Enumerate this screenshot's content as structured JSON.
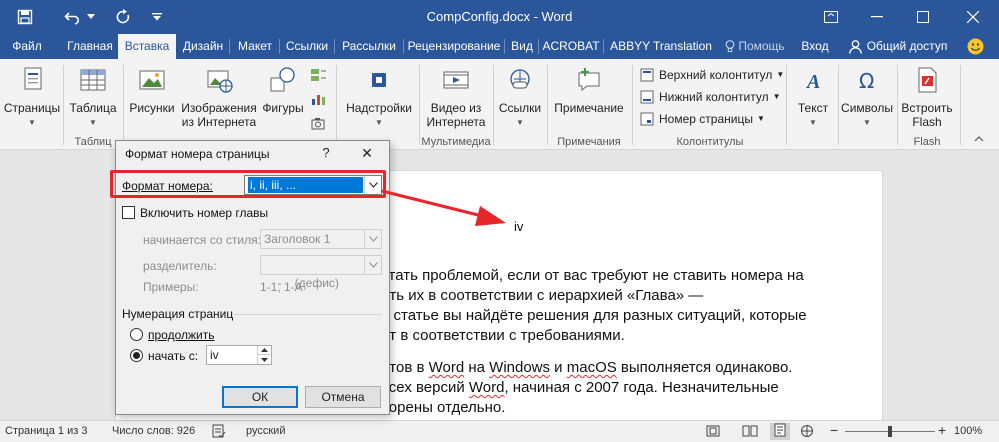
{
  "window": {
    "title": "CompConfig.docx - Word"
  },
  "tabs": [
    {
      "label": "Файл"
    },
    {
      "label": "Главная"
    },
    {
      "label": "Вставка"
    },
    {
      "label": "Дизайн"
    },
    {
      "label": "Макет"
    },
    {
      "label": "Ссылки"
    },
    {
      "label": "Рассылки"
    },
    {
      "label": "Рецензирование"
    },
    {
      "label": "Вид"
    },
    {
      "label": "ACROBAT"
    },
    {
      "label": "ABBYY Translation"
    },
    {
      "label": "Помощь"
    },
    {
      "label": "Вход"
    },
    {
      "label": "Общий доступ"
    }
  ],
  "ribbon": {
    "pages": "Страницы",
    "table": "Таблица",
    "tables_group": "Таблиц",
    "pictures": "Рисунки",
    "online_pictures_1": "Изображения",
    "online_pictures_2": "из Интернета",
    "shapes": "Фигуры",
    "addins": "Надстройки",
    "video_1": "Видео из",
    "video_2": "Интернета",
    "multimedia_group": "Мультимедиа",
    "links": "Ссылки",
    "comment": "Примечание",
    "comments_group": "Примечания",
    "header": "Верхний колонтитул",
    "footer": "Нижний колонтитул",
    "page_number": "Номер страницы",
    "hf_group": "Колонтитулы",
    "text": "Текст",
    "symbols": "Символы",
    "flash_1": "Встроить",
    "flash_2": "Flash",
    "flash_group": "Flash"
  },
  "document": {
    "page_number": "iv",
    "lines": [
      "стать проблемой, если от вас требуют не ставить номера на",
      "ить их в соответствии с иерархией «Глава» —",
      "й статье вы найдёте решения для разных ситуаций, которые",
      "нт в соответствии с требованиями."
    ],
    "para2_pre": "нтов в ",
    "para2_w1": "Word",
    "para2_mid1": " на ",
    "para2_w2": "Windows",
    "para2_mid2": " и ",
    "para2_w3": "macOS",
    "para2_post": " выполняется одинаково.",
    "para3_pre": "всех версий ",
    "para3_w1": "Word",
    "para3_post": ", начиная с 2007 года. Незначительные",
    "para4": "ворены отдельно."
  },
  "dialog": {
    "title": "Формат номера страницы",
    "help": "?",
    "close": "✕",
    "format_label": "Формат номера:",
    "format_value": "i, ii, iii, ...",
    "include_chapter": "Включить номер главы",
    "starts_with_label": "начинается со стиля:",
    "starts_with_value": "Заголовок 1",
    "separator_label": "разделитель:",
    "separator_value": "-    (дефис)",
    "examples_label": "Примеры:",
    "examples_value": "1-1, 1-A",
    "numbering_group": "Нумерация страниц",
    "continue": "продолжить",
    "start_at": "начать с:",
    "start_at_value": "iv",
    "ok": "ОК",
    "cancel": "Отмена"
  },
  "status": {
    "page": "Страница 1 из 3",
    "words": "Число слов: 926",
    "language": "русский",
    "zoom": "100%"
  },
  "colors": {
    "brand": "#2b579a",
    "highlight": "#e8252b",
    "selection": "#0078d7"
  }
}
